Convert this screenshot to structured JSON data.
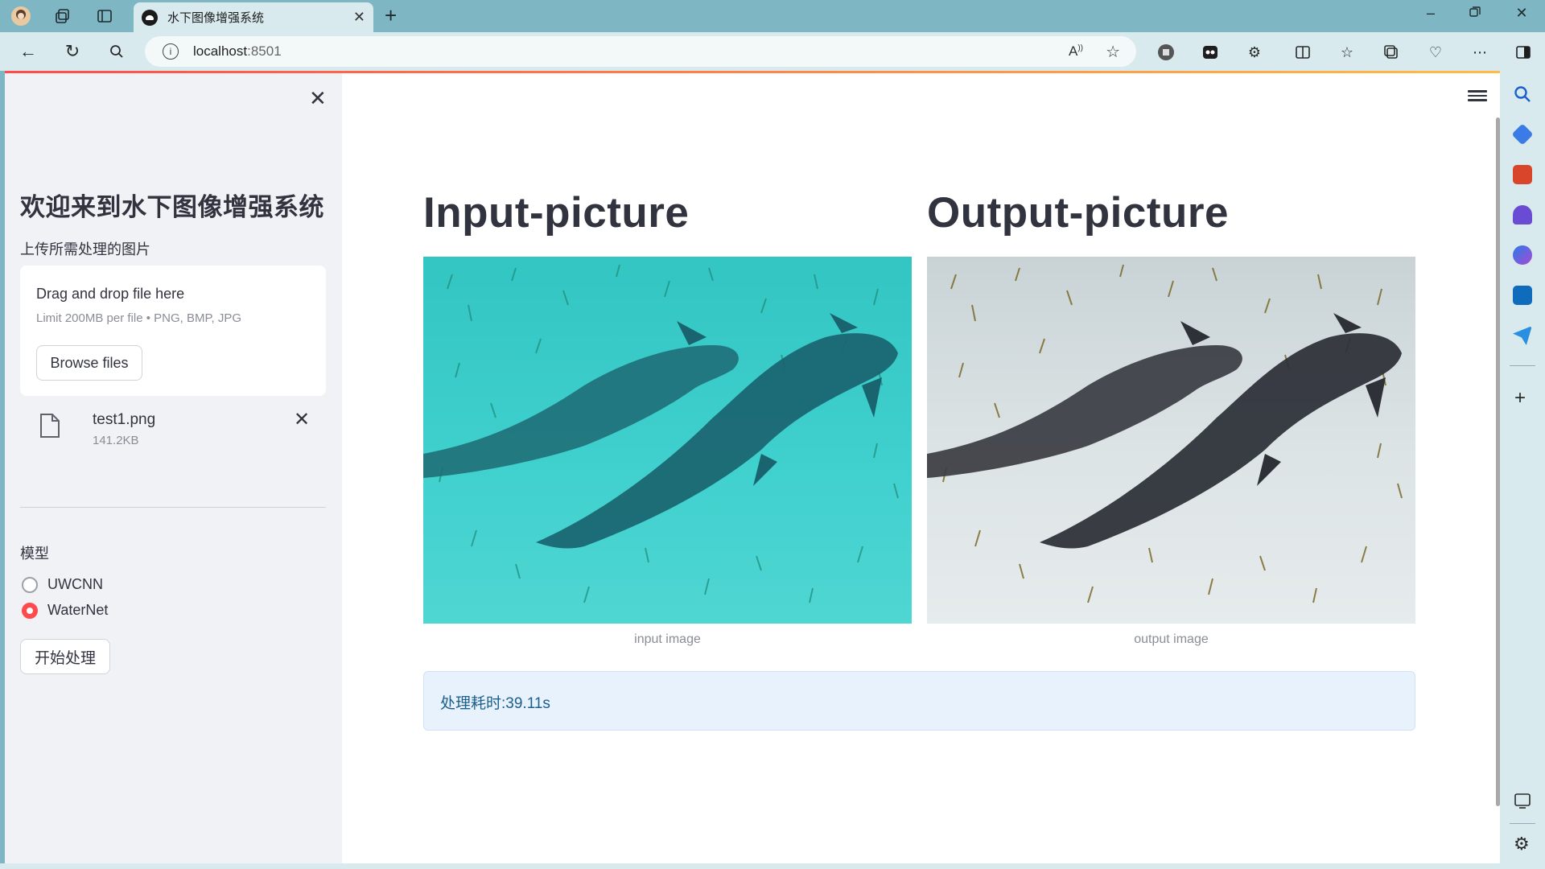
{
  "browser": {
    "tab_title": "水下图像增强系统",
    "new_tab": "+",
    "url_host": "localhost",
    "url_port": ":8501"
  },
  "sidebar": {
    "title": "欢迎来到水下图像增强系统",
    "upload_label": "上传所需处理的图片",
    "dropzone_title": "Drag and drop file here",
    "dropzone_limit": "Limit 200MB per file • PNG, BMP, JPG",
    "browse_button": "Browse files",
    "file_name": "test1.png",
    "file_size": "141.2KB",
    "model_label": "模型",
    "models": [
      {
        "label": "UWCNN",
        "selected": false
      },
      {
        "label": "WaterNet",
        "selected": true
      }
    ],
    "start_button": "开始处理"
  },
  "main": {
    "input_title": "Input-picture",
    "output_title": "Output-picture",
    "input_caption": "input image",
    "output_caption": "output image",
    "status": "处理耗时:39.11s"
  },
  "colors": {
    "accent": "#ff4b4b",
    "sidebar_bg": "#f0f2f6",
    "text": "#31333f",
    "info_bg": "#e8f2fc",
    "browser_frame": "#7fb6c4"
  },
  "icons": [
    "profile-icon",
    "workspaces-icon",
    "tab-actions-icon",
    "close-icon",
    "back-icon",
    "refresh-icon",
    "search-icon",
    "info-icon",
    "read-aloud-icon",
    "favorite-icon",
    "extensions-icon",
    "split-screen-icon",
    "favorites-icon",
    "collections-icon",
    "health-icon",
    "more-icon",
    "sidebar-icon",
    "menu-icon",
    "file-icon"
  ]
}
